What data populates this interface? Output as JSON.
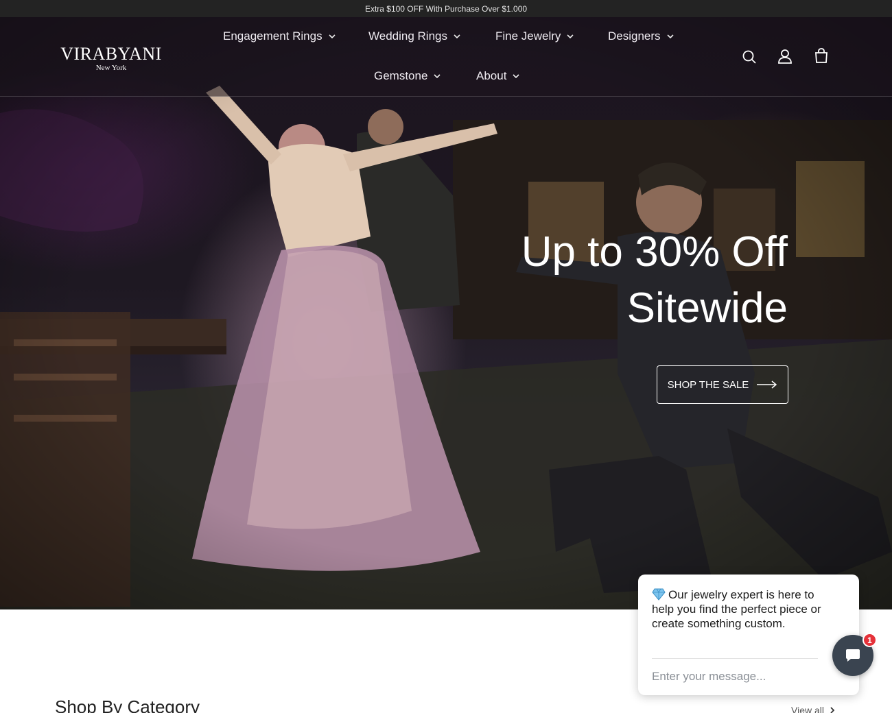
{
  "announcement": {
    "text": "Extra $100 OFF With Purchase Over $1.000"
  },
  "brand": {
    "name": "VIRABYANI",
    "location": "New York"
  },
  "nav": {
    "items": [
      {
        "label": "Engagement Rings"
      },
      {
        "label": "Wedding Rings"
      },
      {
        "label": "Fine Jewelry"
      },
      {
        "label": "Designers"
      },
      {
        "label": "Gemstone"
      },
      {
        "label": "About"
      }
    ]
  },
  "header_icons": [
    "search-icon",
    "account-icon",
    "cart-icon"
  ],
  "hero": {
    "title_line1": "Up to 30% Off",
    "title_line2": "Sitewide",
    "cta_label": "SHOP THE SALE"
  },
  "category_section": {
    "title": "Shop By Category",
    "view_all_label": "View all"
  },
  "chat": {
    "message": "Our jewelry expert is here to help you find the perfect piece or create something custom.",
    "input_placeholder": "Enter your message...",
    "badge_count": "1"
  },
  "colors": {
    "announcement_bg": "#232323",
    "chat_launcher": "#3a4450",
    "badge": "#e5323a"
  }
}
